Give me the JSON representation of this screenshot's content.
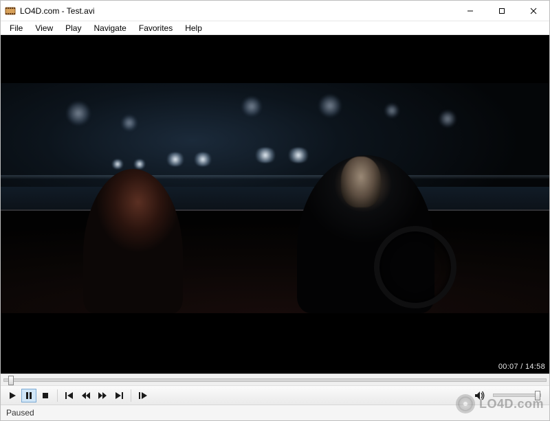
{
  "window": {
    "title": "LO4D.com - Test.avi"
  },
  "menu": {
    "items": [
      "File",
      "View",
      "Play",
      "Navigate",
      "Favorites",
      "Help"
    ]
  },
  "playback": {
    "current_time": "00:07",
    "total_time": "14:58",
    "status": "Paused"
  },
  "watermark": {
    "text": "LO4D.com"
  },
  "controls": {
    "play": "Play",
    "pause": "Pause",
    "stop": "Stop",
    "prev": "Previous",
    "rewind": "Rewind",
    "forward": "Forward",
    "next": "Next",
    "step": "Step"
  }
}
